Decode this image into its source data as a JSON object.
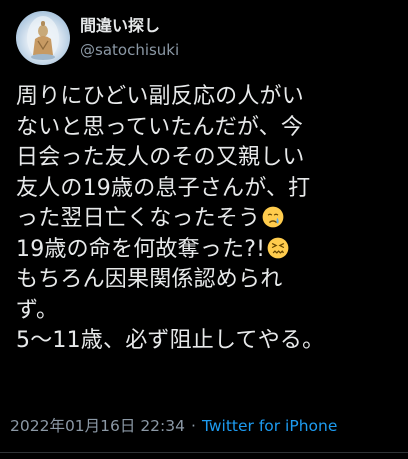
{
  "author": {
    "display_name": "間違い探し",
    "handle": "@satochisuki"
  },
  "tweet": {
    "lines": [
      "周りにひどい副反応の人がい",
      "ないと思っていたんだが、今",
      "日会った友人のその又親しい",
      "友人の19歳の息子さんが、打",
      "った翌日亡くなったそう",
      "19歳の命を何故奪った?!",
      "もちろん因果関係認められ",
      "ず。",
      "5〜11歳、必ず阻止してやる。"
    ],
    "emojis": [
      "crying-face-emoji",
      "confounded-face-emoji"
    ]
  },
  "meta": {
    "timestamp": "2022年01月16日 22:34",
    "separator": "·",
    "source": "Twitter for iPhone"
  },
  "colors": {
    "background": "#000000",
    "text": "#e7e9ea",
    "secondary": "#8b98a5",
    "link": "#1d9bf0"
  }
}
